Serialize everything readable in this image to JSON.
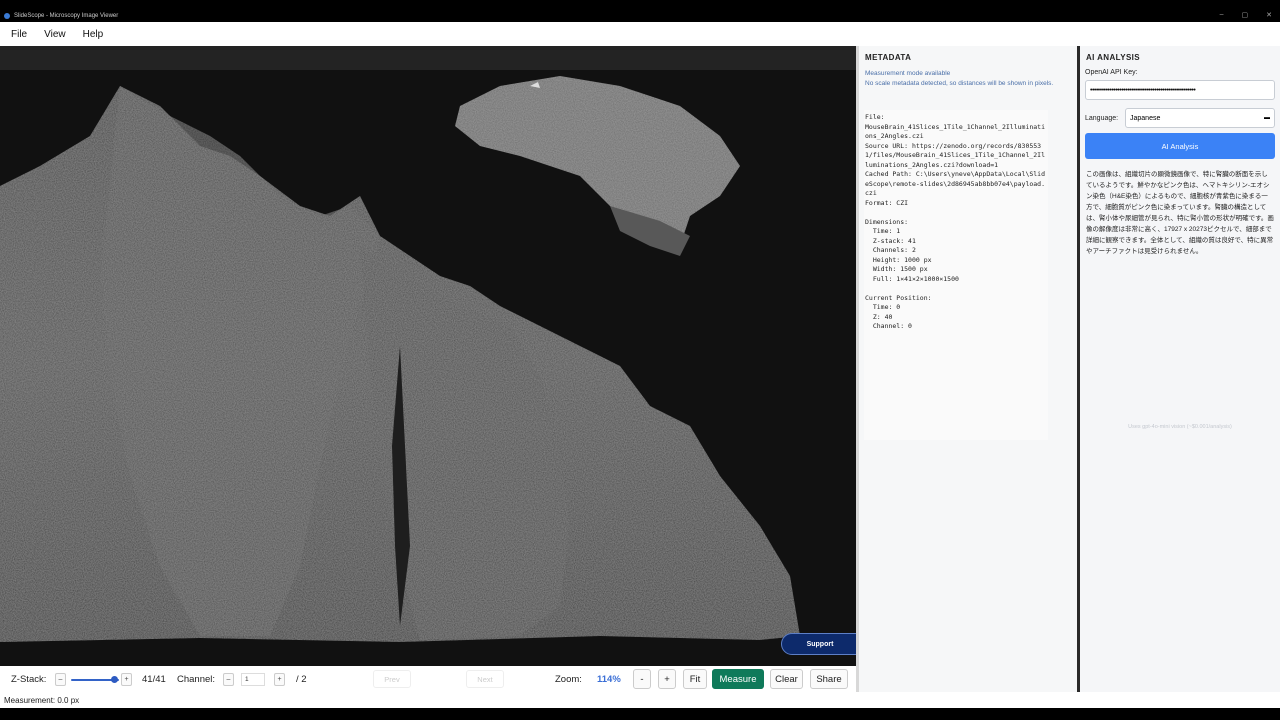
{
  "window": {
    "title": "SlideScope - Microscopy Image Viewer",
    "controls": [
      "–",
      "▢",
      "✕"
    ]
  },
  "menu": [
    "File",
    "View",
    "Help"
  ],
  "viewer": {
    "support_label": "Support"
  },
  "metadata": {
    "title": "METADATA",
    "note": "Measurement mode available\nNo scale metadata detected, so distances will be shown in pixels.",
    "body": "File:\nMouseBrain_41Slices_1Tile_1Channel_2Illuminations_2Angles.czi\nSource URL: https://zenodo.org/records/8305531/files/MouseBrain_41Slices_1Tile_1Channel_2Illuminations_2Angles.czi?download=1\nCached Path: C:\\Users\\yneve\\AppData\\Local\\SlideScope\\remote-slides\\2d86945ab8bb07e4\\payload.czi\nFormat: CZI\n\nDimensions:\n  Time: 1\n  Z-stack: 41\n  Channels: 2\n  Height: 1000 px\n  Width: 1500 px\n  Full: 1×41×2×1000×1500\n\nCurrent Position:\n  Time: 0\n  Z: 40\n  Channel: 0"
  },
  "ai": {
    "title": "AI ANALYSIS",
    "api_key_label": "OpenAI API Key:",
    "api_key_value": "••••••••••••••••••••••••••••••••••••••••••••••••••••••",
    "language_label": "Language:",
    "language_value": "Japanese",
    "button_label": "AI Analysis",
    "result": "この画像は、組織切片の顕微鏡画像で、特に腎臓の断面を示しているようです。鮮やかなピンク色は、ヘマトキシリン-エオシン染色（H&E染色）によるもので、細胞核が青紫色に染まる一方で、細胞質がピンク色に染まっています。腎臓の構造としては、腎小体や尿細管が見られ、特に腎小管の形状が明確です。画像の解像度は非常に高く、17927 x 20273ピクセルで、細部まで詳細に観察できます。全体として、組織の質は良好で、特に異常やアーチファクトは見受けられません。",
    "footer": "Uses gpt-4o-mini vision (~$0.001/analysis)"
  },
  "toolbar": {
    "zstack_label": "Z-Stack:",
    "zstack_minus": "–",
    "zstack_plus": "+",
    "zstack_value": "41/41",
    "zstack_fraction": 0.83,
    "channel_label": "Channel:",
    "channel_minus": "–",
    "channel_value": "1",
    "channel_plus": "+",
    "channel_total": "/ 2",
    "prev_label": "Prev",
    "next_label": "Next",
    "zoom_label": "Zoom:",
    "zoom_value": "114%",
    "zoom_minus": "-",
    "zoom_plus": "+",
    "fit_label": "Fit",
    "measure_label": "Measure",
    "clear_label": "Clear",
    "share_label": "Share"
  },
  "status": {
    "measurement": "Measurement: 0.0 px"
  }
}
